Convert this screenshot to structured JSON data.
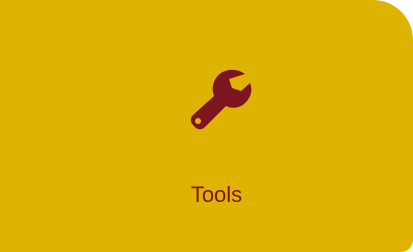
{
  "tile": {
    "label": "Tools",
    "icon": "wrench-icon",
    "background_color": "#dfb301",
    "accent_color": "#7d1420"
  }
}
